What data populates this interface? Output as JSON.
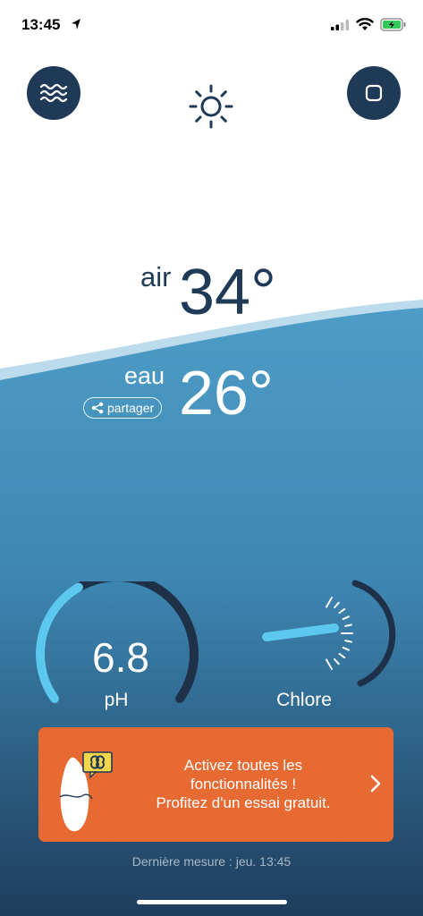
{
  "status_bar": {
    "time": "13:45"
  },
  "weather": {
    "icon": "sun-icon"
  },
  "temperatures": {
    "air_label": "air",
    "air_value": "34°",
    "water_label": "eau",
    "water_value": "26°",
    "share_label": "partager"
  },
  "gauges": {
    "ph": {
      "value": "6.8",
      "label": "pH",
      "fill_fraction": 0.38
    },
    "chlore": {
      "label": "Chlore"
    }
  },
  "promo": {
    "line1": "Activez toutes les",
    "line2": "fonctionnalités !",
    "line3": "Profitez d'un essai gratuit."
  },
  "footer": {
    "last_measure": "Dernière mesure : jeu. 13:45"
  },
  "colors": {
    "navy": "#1f3a57",
    "water_top": "#4a9ac4",
    "water_bottom": "#1e3d5c",
    "gauge_accent": "#5cc8ee",
    "promo": "#e86a33"
  }
}
